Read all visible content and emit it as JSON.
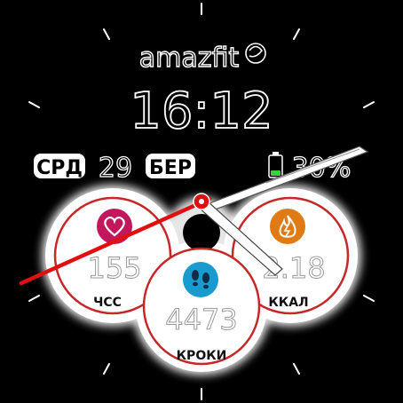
{
  "brand": "amazfit",
  "time": "16:12",
  "date": {
    "weekday": "СРД",
    "day": "29",
    "month": "БЕР"
  },
  "battery": {
    "percent_label": "30%",
    "level": 0.3
  },
  "widgets": {
    "heart": {
      "value": "155",
      "label": "ЧСС",
      "icon": "heart-icon",
      "icon_color": "#c2185b"
    },
    "steps": {
      "value": "4473",
      "label": "КРОКИ",
      "icon": "footsteps-icon",
      "icon_color": "#1a9bd0"
    },
    "calories": {
      "value": "2.18",
      "label": "ККАЛ",
      "icon": "flame-icon",
      "icon_color": "#e07a17"
    }
  },
  "colors": {
    "background": "#000000",
    "ring": "#c62828",
    "second_hand": "#e01010",
    "battery_fill": "#3bd13b"
  }
}
